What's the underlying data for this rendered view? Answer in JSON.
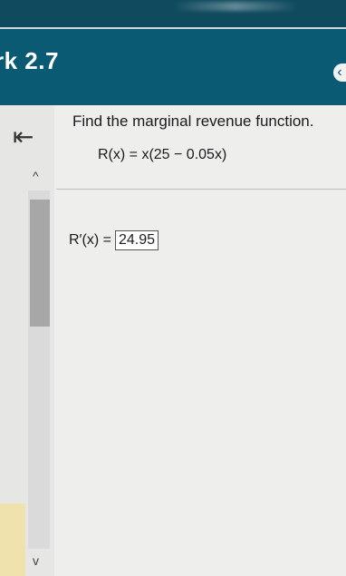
{
  "header": {
    "title": "rk 2.7"
  },
  "nav": {
    "back_icon": "back-to-start-icon",
    "collapse_icon": "chevron-left-icon"
  },
  "scrollbar": {
    "up_icon": "chevron-up-icon",
    "down_icon": "chevron-down-icon"
  },
  "problem": {
    "prompt": "Find the marginal revenue function.",
    "given": "R(x) = x(25 − 0.05x)",
    "answer_label": "R′(x) =",
    "answer_value": "24.95"
  },
  "colors": {
    "header": "#0b5a73",
    "top_strip": "#0f4a5e",
    "background": "#eeeeec"
  }
}
